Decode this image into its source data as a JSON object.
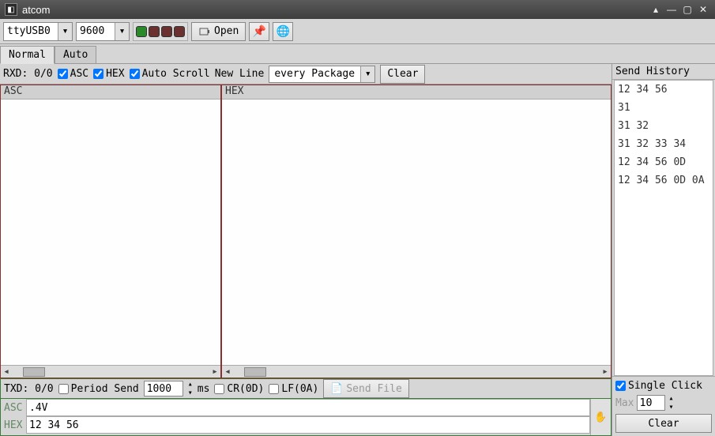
{
  "window": {
    "title": "atcom"
  },
  "toolbar": {
    "port": "ttyUSB0",
    "baud": "9600",
    "open_label": "Open"
  },
  "tabs": {
    "normal": "Normal",
    "auto": "Auto"
  },
  "rx": {
    "label": "RXD: 0/0",
    "asc": "ASC",
    "hex": "HEX",
    "autoscroll": "Auto Scroll",
    "newline": "New Line",
    "newline_mode": "every Package",
    "clear": "Clear"
  },
  "panes": {
    "asc_header": "ASC",
    "hex_header": "HEX"
  },
  "tx": {
    "label": "TXD: 0/0",
    "period_send": "Period Send",
    "period_value": "1000",
    "ms": "ms",
    "cr": "CR(0D)",
    "lf": "LF(0A)",
    "send_file": "Send File"
  },
  "inputs": {
    "asc_label": "ASC",
    "asc_value": ".4V",
    "hex_label": "HEX",
    "hex_value": "12 34 56"
  },
  "history": {
    "header": "Send History",
    "items": [
      "12 34 56",
      "31",
      "31 32",
      "31 32 33 34",
      "12 34 56 0D",
      "12 34 56 0D 0A"
    ],
    "single_click": "Single Click",
    "max_label": "Max",
    "max_value": "10",
    "clear": "Clear"
  }
}
